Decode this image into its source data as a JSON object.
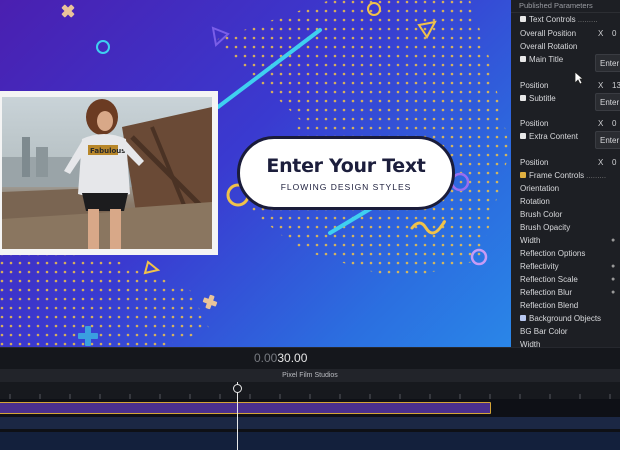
{
  "viewer": {
    "title_main": "Enter Your Text",
    "title_sub": "FLOWING DESIGN STYLES",
    "photo_shirt_text": "Fabulous"
  },
  "panel": {
    "header": "Published Parameters",
    "rows": {
      "text_controls": "Text Controls",
      "overall_position": "Overall Position",
      "overall_position_x": "X",
      "overall_position_v": "0",
      "overall_rotation": "Overall Rotation",
      "main_title": "Main Title",
      "main_title_field": "Enter",
      "position1": "Position",
      "position1_x": "X",
      "position1_v": "13",
      "subtitle": "Subtitle",
      "subtitle_field": "Enter",
      "position2": "Position",
      "position2_x": "X",
      "position2_v": "0",
      "extra_content": "Extra Content",
      "extra_content_field": "Enter",
      "position3": "Position",
      "position3_x": "X",
      "position3_v": "0",
      "frame_controls": "Frame Controls",
      "orientation": "Orientation",
      "rotation": "Rotation",
      "brush_color": "Brush Color",
      "brush_opacity": "Brush Opacity",
      "width1": "Width",
      "reflection_options": "Reflection Options",
      "reflectivity": "Reflectivity",
      "reflection_scale": "Reflection Scale",
      "reflection_blur": "Reflection Blur",
      "reflection_blend": "Reflection Blend",
      "background_objects": "Background Objects",
      "bg_bar_color": "BG Bar Color",
      "width2": "Width"
    }
  },
  "timeline": {
    "timecode_dim": "0.00",
    "timecode_main": "30.00",
    "project_name": "Pixel Film Studios"
  },
  "colors": {
    "clip_fill": "#4a2f8e",
    "clip_border": "#d4a437",
    "accent_cyan": "#3fd0f0",
    "accent_yellow": "#f0c24a"
  }
}
